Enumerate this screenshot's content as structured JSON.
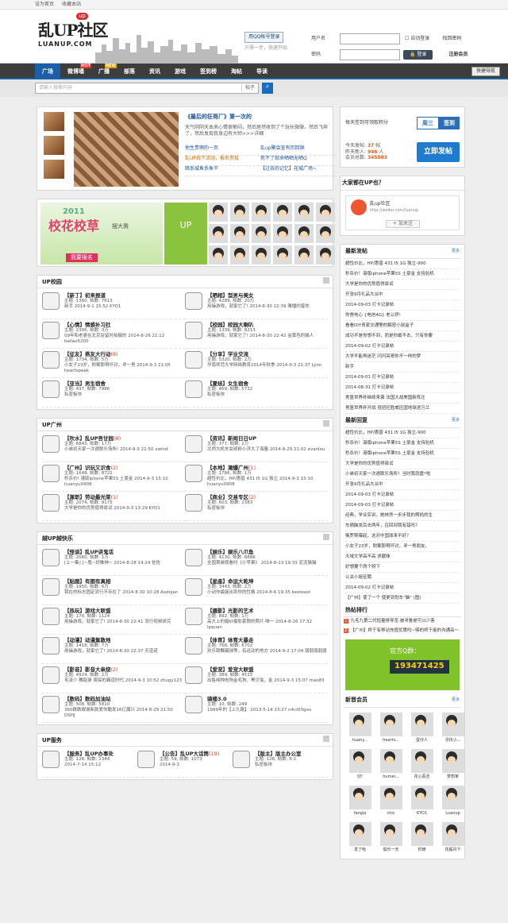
{
  "topbar": {
    "home": "设为首页",
    "fav": "收藏本站"
  },
  "logo": {
    "main": "乱UP社区",
    "sub": "LUANUP.COM",
    "badge": "up"
  },
  "qq": {
    "button": "用QQ帐号登录",
    "tip": "只需一步，快速开始"
  },
  "login": {
    "user_label": "用户名",
    "pass_label": "密码",
    "auto": "自动登录",
    "find": "找回密码",
    "btn": "登录",
    "reg": "注册会员"
  },
  "nav": {
    "items": [
      "广场",
      "微博墙",
      "广播",
      "部落",
      "资讯",
      "游戏",
      "签到榜",
      "淘帖",
      "导读"
    ],
    "hot": "HOT",
    "new": "NEW",
    "quick": "快捷导航"
  },
  "search": {
    "placeholder": "请输入搜索内容",
    "type": "帖子"
  },
  "featured": {
    "title": "《最后的狂哥厂》第一次的",
    "desc": "天气阴阴天本来心情很郁闷，然后居然收到了个玩长微微，然后飞奔了，然后发现我身边有大师>>>详细",
    "links": [
      [
        "他生贵啊的一页",
        "乱up聚会宣有历回顾"
      ],
      [
        "乱UP线下活动，报名参投",
        "死不了就来晒晒无晒Q"
      ],
      [
        "暗系城鱼系鱼干",
        "【过去的记忆】花城广场~"
      ]
    ]
  },
  "banner": {
    "year": "2011",
    "title": "校花校草",
    "sub": "摆大赛",
    "signup": "我要报名",
    "up": "UP"
  },
  "sections": [
    {
      "title": "UP校园",
      "items": [
        {
          "name": "【新丁】初来报道",
          "cnt": "",
          "m1": "主题: 1360, 帖数: 7613",
          "m2": "新手 2014-9-1 15:52 KYO1"
        },
        {
          "name": "【晒相】型男与美女",
          "cnt": "",
          "m1": "主题: 4289, 帖数: 20万",
          "m2": "用操游戏，就家它了! 2014-8-30 22:39 雅播的蜜你"
        },
        {
          "name": "【心情】情感补习社",
          "cnt": "",
          "m1": "主题: 2395, 帖数: 3万",
          "m2": "09年和老婆在北京驻留时拍摄的 2014-8-26 21:12 bailao5200"
        },
        {
          "name": "【校园】校园大喇叭",
          "cnt": "",
          "m1": "主题: 1339, 帖数: 8213",
          "m2": "用操游戏，就家它了! 2014-8-30 22:42 金黄色的猫人"
        },
        {
          "name": "【征友】燕友大行动",
          "cnt": "(8)",
          "m1": "主题: 1734, 帖数: 5万",
          "m2": "小女子23岁，附案那啊坏对，寻一男 2014-9-3 21:05 heartspeak"
        },
        {
          "name": "【分享】学业交流",
          "cnt": "",
          "m1": "主题: 5320, 帖数: 2万",
          "m2": "华南师范大学网络教育2014年秋季 2014-9-3 21:37 Lynn"
        },
        {
          "name": "【亚当】男生宿舍",
          "cnt": "",
          "m1": "主题: 437, 帖数: 7986",
          "m2": "私密板块"
        },
        {
          "name": "【夏娃】女生宿舍",
          "cnt": "",
          "m1": "主题: 469, 帖数: 5732",
          "m2": "私密板块"
        }
      ]
    },
    {
      "title": "UP广州",
      "items": [
        {
          "name": "【吹水】乱UP吾甘园",
          "cnt": "(8)",
          "m1": "主题: 6843, 帖数: 17万",
          "m2": "小弟初天家一次遇联乐场所! 2014-9-3 21:50 xwind"
        },
        {
          "name": "【资讯】新闻日日UP",
          "cnt": "",
          "m1": "主题: 377, 帖数: 2万",
          "m2": "北师大机车女硕粉小济大了海量 2014-8-29 21:02 evanlou"
        },
        {
          "name": "【广州】识玩又识食",
          "cnt": "(2)",
          "m1": "主题: 1648, 帖数: 8722",
          "m2": "秒杀价! 港版iphone苹果5S 土豪金 2014-9-3 15:10 huanyu0908"
        },
        {
          "name": "【本地】潮爆广州",
          "cnt": "(1)",
          "m1": "主题: 1786, 帖数: 1万",
          "m2": "超性价比，HP/惠普 431 I5 1G 独立 2014-9-3 15:10 huanyu0908"
        },
        {
          "name": "【兼职】劳动最光荣",
          "cnt": "(1)",
          "m1": "主题: 2074, 帖数: 9175",
          "m2": "大学是你的优势值得尝试 2014-9-3 13:29 KYO1"
        },
        {
          "name": "【商业】交易专区",
          "cnt": "(2)",
          "m1": "主题: 603, 帖数: 2383",
          "m2": "私密板块"
        }
      ]
    },
    {
      "title": "越UP越快乐",
      "items": [
        {
          "name": "【怪谈】乱UP讲鬼话",
          "cnt": "",
          "m1": "主题: 2060, 帖数: 1万",
          "m2": "[上一集] [~鬼~好推神~ 2014-8-28 14:24 佐佐"
        },
        {
          "name": "【娱乐】娱乐八爪鱼",
          "cnt": "",
          "m1": "主题: 4130, 帖数: 8886",
          "m2": "全国首映观看时《小苹果》 2014-8-13 19:33 泥泥猫猫"
        },
        {
          "name": "【贴图】有图有真相",
          "cnt": "",
          "m1": "主题: 1950, 帖数: 6万",
          "m2": "我在的标志固定流行不存在了 2014-8-30 10:28 Aodojan"
        },
        {
          "name": "【星座】命运大乾坤",
          "cnt": "",
          "m1": "主题: 3443, 帖数: 2万",
          "m2": "小动作最能出卖你的性格 2014-8-6 19:35 besteast"
        },
        {
          "name": "【热玩】游戏大联盟",
          "cnt": "",
          "m1": "主题: 170, 帖数: 1124",
          "m2": "用操游戏，就家它了! 2014-8-30 22:41 流行视频研究"
        },
        {
          "name": "【摄影】光影的艺术",
          "cnt": "",
          "m1": "主题: 892, 帖数: 1万",
          "m2": "高大上的婚纱摄影套照的照片·唯一 2014-8-26 17:32 lpquan"
        },
        {
          "name": "【动漫】动漫集散地",
          "cnt": "",
          "m1": "主题: 1418, 帖数: 7万",
          "m2": "用操游戏，就家它了! 2014-8-30 22:37 天道诺"
        },
        {
          "name": "【体育】体育大暴走",
          "cnt": "",
          "m1": "主题: 768, 帖数: 6702",
          "m2": "欢乐跳舞踢球等，有运动的地方 2014-9-2 17:04 弱弱弱弱弱"
        },
        {
          "name": "【影音】影音大串烧",
          "cnt": "(2)",
          "m1": "主题: 4924, 帖数: 2万",
          "m2": "毛泽少·舞蹈录 周琛的霸道时代 2014-9-3 10:52 zhugy123"
        },
        {
          "name": "【爱宠】爱宠大联盟",
          "cnt": "",
          "m1": "主题: 389, 帖数: 4515",
          "m2": "出售纯种肉狗金毛狗、黑贝兔，金 2014-9-3 15:07 mao83"
        },
        {
          "name": "【数码】数码加油站",
          "cnt": "",
          "m1": "主题: 508, 帖数: 5810",
          "m2": "360跌跌眼谢新款爱你酷发16亿属兴 2014-8-29 21:50 DSHJ"
        },
        {
          "name": "骑楼3.0",
          "cnt": "",
          "m1": "主题: 10, 帖数: 249",
          "m2": "1999年的【上九路】 2013-5-14 23:27 n4cdf3gou"
        }
      ]
    },
    {
      "title": "UP服务",
      "items": [
        {
          "name": "【服务】乱UP办事处",
          "cnt": "",
          "m1": "主题: 128, 帖数: 1344",
          "m2": "2014-7-14 15:12"
        },
        {
          "name": "【公告】乱UP大话筒",
          "cnt": "(19)",
          "m1": "主题: 59, 帖数: 1073",
          "m2": "2014-9-3"
        },
        {
          "name": "【版主】版主办公室",
          "cnt": "",
          "m1": "主题: 128, 帖数: 8 2",
          "m2": "私密板块"
        }
      ]
    }
  ],
  "right": {
    "qiandao": {
      "text": "每天签到可领取积分",
      "day": "周三",
      "btn": "签到"
    },
    "stats": {
      "today_label": "今天发帖:",
      "today": "37",
      "today_u": "帖",
      "yest_label": "昨天新人:",
      "yest": "946",
      "yest_u": "人",
      "total_label": "会员总数:",
      "total": "345583",
      "post_btn": "立即发帖"
    },
    "weibo": {
      "title": "大家都在UP也？",
      "name": "乱up社区",
      "url": "http://weibo.com/luanup",
      "follow": "加关注"
    },
    "newest": {
      "title": "最新发帖",
      "more": "更多",
      "items": [
        "超性价比，HP/惠普 431 I5 1G 独立-900",
        "秒杀价！港版iphone苹果5S 土豪金 支持验机",
        "大学是你的优势值得尝试",
        "开张9月礼品大派中",
        "2014-09-03 打卡记录帖",
        "你爸电心 {电信4G} 老公挤!",
        "看看DIY青家交通警的解密小鼠盒子",
        "成功不是你想不到，而是你敢不去，只有你要",
        "2014-09-02 打卡记录帖",
        "大学不能再迷茫 闪闪亮哥你不一样的梦",
        "新手",
        "2014-09-01 打卡记录帖",
        "2014-08-31 打卡记录帖",
        "男篮世界杯继续来袭 法国大战美国新阵迁",
        "男篮世界杯开战 扭扭狂胜威压国地球进万兰"
      ]
    },
    "reply": {
      "title": "最新回复",
      "more": "更多",
      "items": [
        "超性价比，HP/惠普 431 I5 1G 独立-900",
        "秒杀价！港版iphone苹果5S 土豪金 支持验机",
        "秒杀价！港版iphone苹果5S 土豪金 支持验机",
        "大学是你的优势值得尝试",
        "小弟初天家一次遇联乐场所！当时我就震*啦",
        "开张9月礼品大派中",
        "2014-09-03 打卡记录帖",
        "2014-09-03 打卡记录帖",
        "经典，学业实训，她林然一步步我的啊妈的生",
        "车祸脑发后去两年，召回到我有错吗？",
        "俄罗斯曝起，这对中国球来不好？",
        "小女子23岁，附案那啊坏对，寻一男朋友。",
        "天域文学高不高 求献咪",
        "好想要个两个呀下",
        "公关小姐征聘",
        "2014-09-02 打卡记录帖",
        "【广州】使了一个 使更到划车\"脑\" (图)"
      ]
    },
    "hot": {
      "title": "热帖排行",
      "items": [
        "九毛九第二代短量排导览·被寻鲁是可以少客",
        "【广州】终于有移动充值优惠吗~够的终于能的沟通高～"
      ]
    },
    "qqgroup": {
      "label": "官方Q群：",
      "num": "193471425"
    },
    "members": {
      "title": "新晋会员",
      "more": "更多",
      "items": [
        "huany...",
        "hearts...",
        "蛋仔人",
        "寻找小...",
        "切!",
        "humei...",
        "花心恶丞",
        "梦想家",
        "fangla",
        "chic",
        "KYO1",
        "Luanup",
        "发了哈",
        "俱乐一天",
        "钓琦",
        "花般月下"
      ]
    }
  }
}
